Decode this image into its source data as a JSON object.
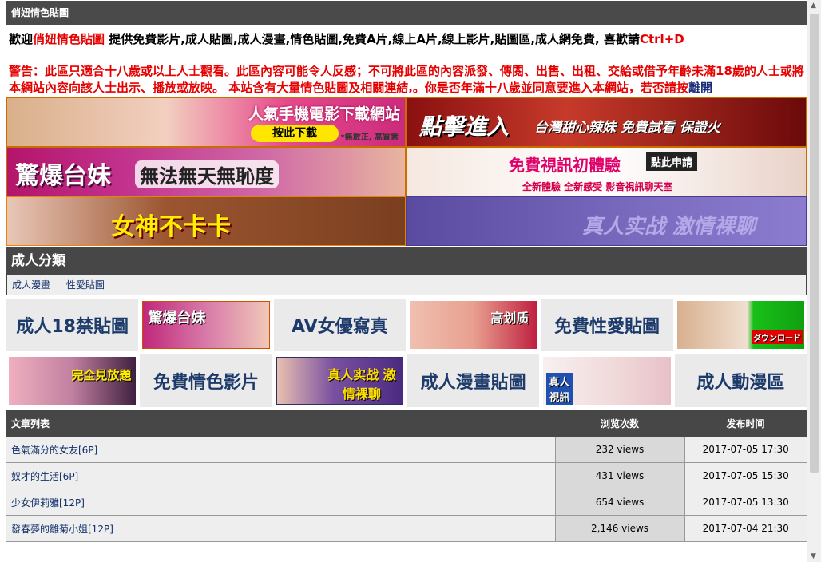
{
  "site_title": "俏妞情色貼圖",
  "welcome": {
    "prefix": "歡迎",
    "site_name": "俏妞情色貼圖",
    "body": " 提供免費影片,成人貼圖,成人漫畫,情色貼圖,免費A片,線上A片,線上影片,貼圖區,成人網免費, 喜歡請",
    "shortcut": "Ctrl+D"
  },
  "warning": {
    "text": "警告：此區只適合十八歲或以上人士觀看。此區內容可能令人反感；不可將此區的內容派發、傳閱、出售、出租、交給或借予年齡未滿18歲的人士或將本網站內容向該人士出示、播放或放映。 本站含有大量情色貼圖及相關連結,。你是否年滿十八歲並同意要進入本網站，若否請按",
    "leave_link": "離開"
  },
  "banners": {
    "b1": {
      "title": "人氣手機電影下載網站",
      "button": "按此下載",
      "note": "*無敢正, 高質素"
    },
    "b2": {
      "title": "點擊進入",
      "sub": "台灣甜心辣妹 免費試看 保證火"
    },
    "b3": {
      "title": "驚爆台妹",
      "sub": "無法無天無恥度"
    },
    "b4": {
      "title": "免費視訊初體驗",
      "button": "點此申請",
      "sub": "全新體驗 全新感受 影音視訊聊天室"
    },
    "b5": {
      "title": "女神不卡卡"
    },
    "b6": {
      "title": "真人实战 激情裸聊"
    }
  },
  "categories": {
    "heading": "成人分類",
    "links": [
      "成人漫畫",
      "性愛貼圖"
    ]
  },
  "tiles": {
    "t1": "成人18禁貼圖",
    "t2_img": "驚爆台妹",
    "t3": "AV女優寫真",
    "t4_img": "高划质",
    "t5": "免費性愛貼圖",
    "t6_img": "ダウンロード",
    "t7_img": "完全見放題",
    "t8": "免費情色影片",
    "t9_img": "真人实战 激情裸聊",
    "t10": "成人漫畫貼圖",
    "t11_img": "真人 視訊",
    "t12": "成人動漫區"
  },
  "table": {
    "headers": [
      "文章列表",
      "浏览次数",
      "发布时间"
    ],
    "rows": [
      {
        "title": "色氣滿分的女友[6P]",
        "views": "232 views",
        "date": "2017-07-05 17:30"
      },
      {
        "title": "奴才的生活[6P]",
        "views": "431 views",
        "date": "2017-07-05 15:30"
      },
      {
        "title": "少女伊莉雅[12P]",
        "views": "654 views",
        "date": "2017-07-05 13:30"
      },
      {
        "title": "發春夢的雛菊小姐[12P]",
        "views": "2,146 views",
        "date": "2017-07-04 21:30"
      }
    ]
  },
  "colors": {
    "warning_red": "#e60000",
    "header_gray": "#474747",
    "link_blue": "#10306a"
  }
}
